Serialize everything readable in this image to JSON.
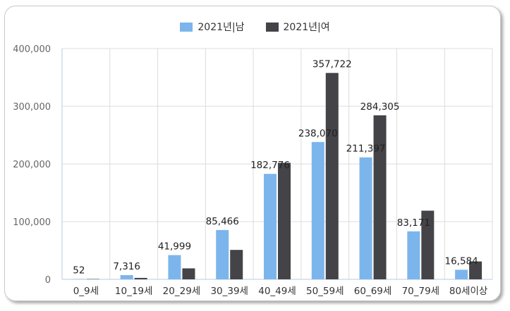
{
  "chart_data": {
    "type": "bar",
    "categories": [
      "0_9세",
      "10_19세",
      "20_29세",
      "30_39세",
      "40_49세",
      "50_59세",
      "60_69세",
      "70_79세",
      "80세이상"
    ],
    "series": [
      {
        "name": "2021년|남",
        "color": "#7cb5ec",
        "values": [
          52,
          7316,
          41999,
          85466,
          182776,
          238070,
          211397,
          83171,
          16584
        ]
      },
      {
        "name": "2021년|여",
        "color": "#434348",
        "values": [
          50,
          2500,
          19000,
          51000,
          202000,
          357722,
          284305,
          119000,
          31000
        ]
      }
    ],
    "labeled": [
      {
        "series": 0,
        "index": 0,
        "text": "52"
      },
      {
        "series": 0,
        "index": 1,
        "text": "7,316"
      },
      {
        "series": 0,
        "index": 2,
        "text": "41,999"
      },
      {
        "series": 0,
        "index": 3,
        "text": "85,466"
      },
      {
        "series": 0,
        "index": 4,
        "text": "182,776"
      },
      {
        "series": 0,
        "index": 5,
        "text": "238,070"
      },
      {
        "series": 1,
        "index": 5,
        "text": "357,722"
      },
      {
        "series": 0,
        "index": 6,
        "text": "211,397"
      },
      {
        "series": 1,
        "index": 6,
        "text": "284,305"
      },
      {
        "series": 0,
        "index": 7,
        "text": "83,171"
      },
      {
        "series": 0,
        "index": 8,
        "text": "16,584"
      }
    ],
    "yticks": [
      0,
      100000,
      200000,
      300000,
      400000
    ],
    "ytick_labels": [
      "0",
      "100,000",
      "200,000",
      "300,000",
      "400,000"
    ],
    "ylim": [
      0,
      400000
    ],
    "grid": true,
    "legend": "top-center",
    "title": "",
    "xlabel": "",
    "ylabel": ""
  }
}
